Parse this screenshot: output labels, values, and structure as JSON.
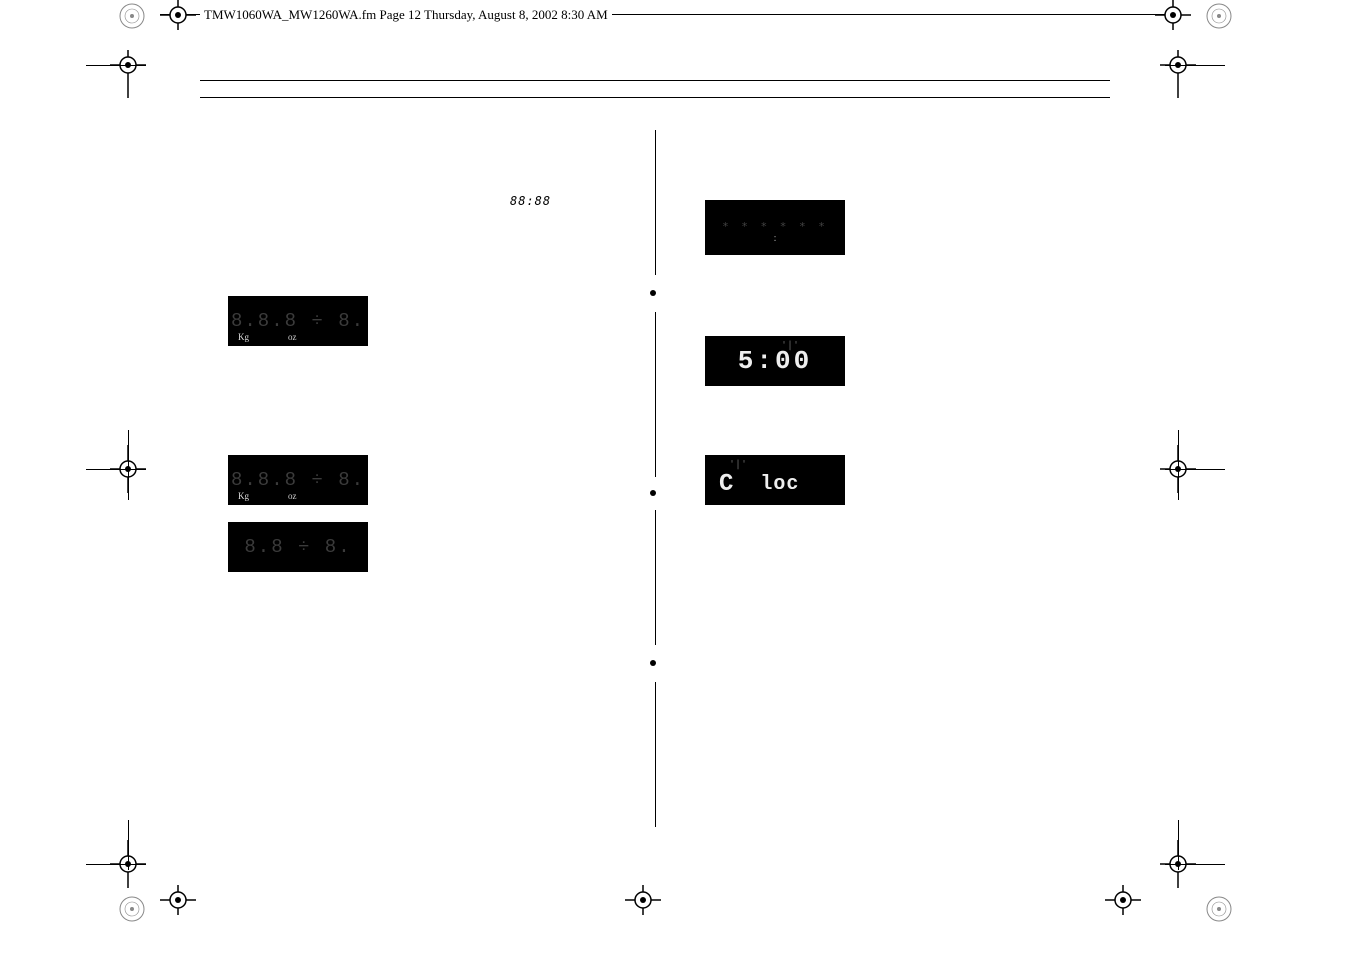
{
  "header": {
    "text": "TMW1060WA_MW1260WA.fm  Page 12  Thursday, August 8, 2002  8:30 AM"
  },
  "clock_icon": "88:88",
  "left_displays": {
    "d1": {
      "digits": "8.8.8 ÷ 8.",
      "unit_kg": "Kg",
      "unit_oz": "oz"
    },
    "d2": {
      "digits": "8.8.8 ÷ 8.",
      "unit_kg": "Kg",
      "unit_oz": "oz"
    },
    "d3": {
      "digits": "8.8 ÷ 8."
    }
  },
  "right_displays": {
    "r1": {
      "digits": "* * *  * * *",
      "sep": ":"
    },
    "r2": {
      "time": "5:00"
    },
    "r3": {
      "label": "C",
      "loc": "loc"
    }
  }
}
